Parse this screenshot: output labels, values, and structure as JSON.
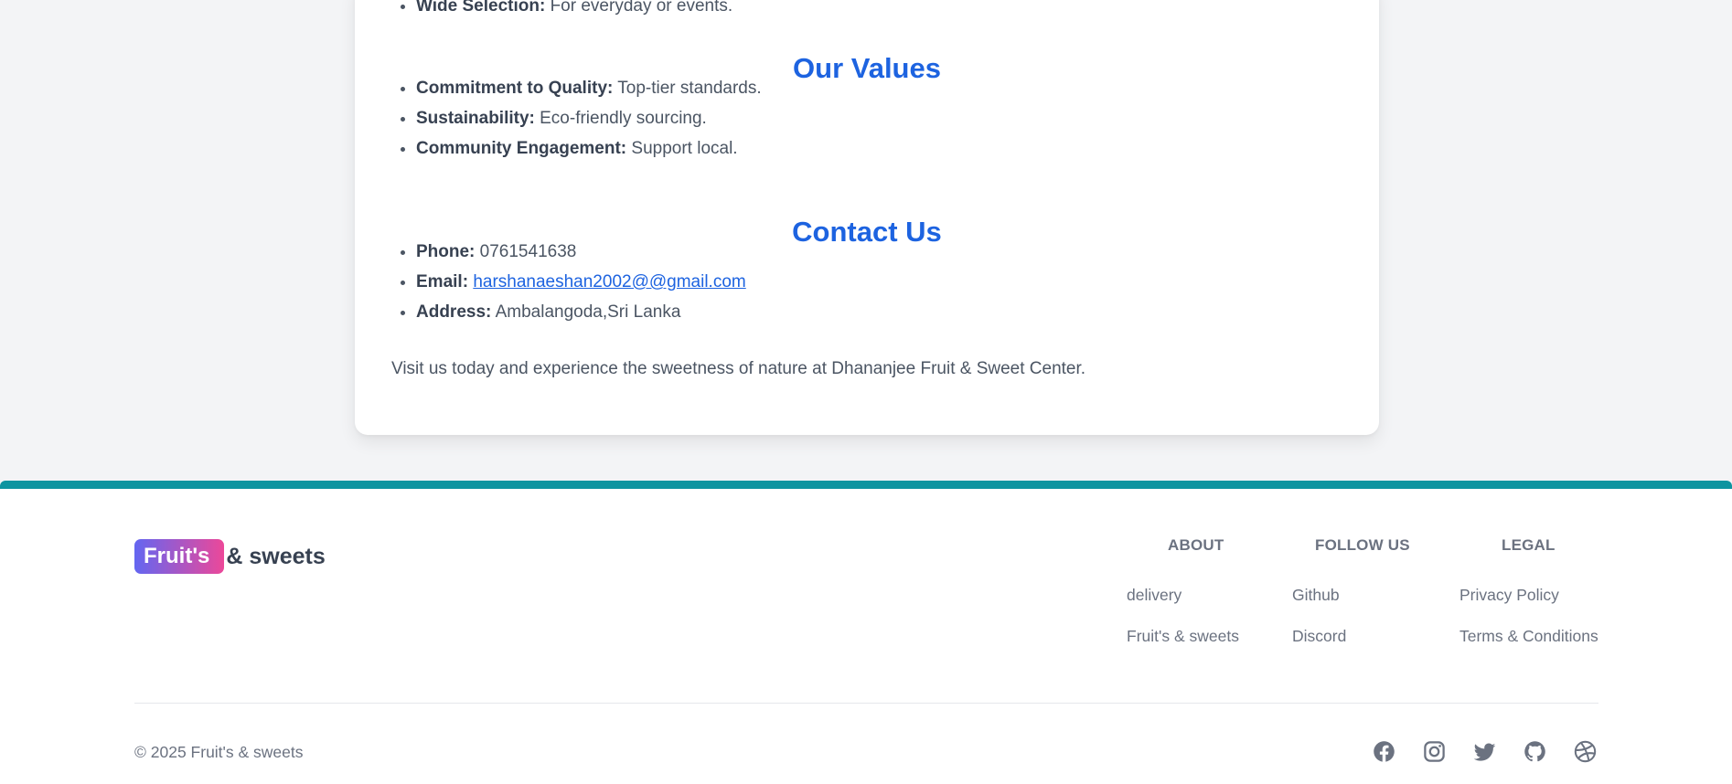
{
  "content": {
    "top_item": {
      "label": "Wide Selection:",
      "text": " For everyday or events."
    },
    "values_heading": "Our Values",
    "values": [
      {
        "label": "Commitment to Quality:",
        "text": " Top-tier standards."
      },
      {
        "label": "Sustainability:",
        "text": " Eco-friendly sourcing."
      },
      {
        "label": "Community Engagement:",
        "text": " Support local."
      }
    ],
    "contact_heading": "Contact Us",
    "contact": {
      "phone_label": "Phone:",
      "phone": " 0761541638",
      "email_label": "Email:",
      "email": "harshanaeshan2002@@gmail.com",
      "address_label": "Address:",
      "address": " Ambalangoda,Sri Lanka"
    },
    "closing": "Visit us today and experience the sweetness of nature at Dhananjee Fruit & Sweet Center."
  },
  "footer": {
    "logo_badge": "Fruit's",
    "logo_text": "& sweets",
    "about": {
      "heading": "ABOUT",
      "links": [
        "delivery",
        "Fruit's & sweets"
      ]
    },
    "follow": {
      "heading": "FOLLOW US",
      "links": [
        "Github",
        "Discord"
      ]
    },
    "legal": {
      "heading": "LEGAL",
      "links": [
        "Privacy Policy",
        "Terms & Conditions"
      ]
    },
    "copyright": "© 2025 Fruit's & sweets",
    "socials": [
      "facebook-icon",
      "instagram-icon",
      "twitter-icon",
      "github-icon",
      "dribbble-icon"
    ]
  },
  "colors": {
    "heading": "#1d63e0",
    "accent_bar": "#0e94a0",
    "badge_gradient_start": "#6366f1",
    "badge_gradient_end": "#ec4899"
  }
}
